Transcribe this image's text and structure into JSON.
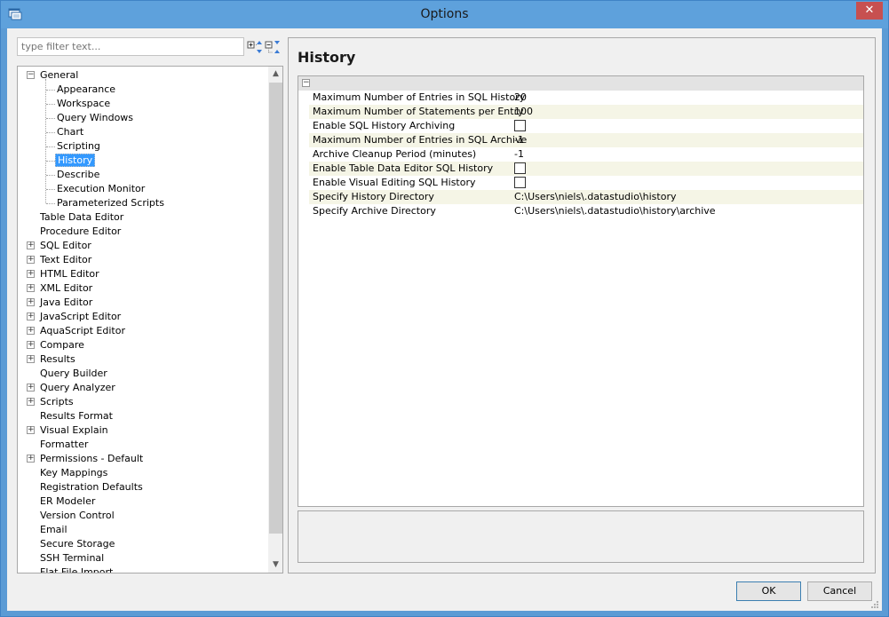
{
  "window": {
    "title": "Options",
    "close_glyph": "✕"
  },
  "filter": {
    "placeholder": "type filter text...",
    "expand_all_icon": "expand-all-icon",
    "collapse_all_icon": "collapse-all-icon"
  },
  "tree": {
    "items": [
      {
        "label": "General",
        "level": 0,
        "expander": "−"
      },
      {
        "label": "Appearance",
        "level": 1
      },
      {
        "label": "Workspace",
        "level": 1
      },
      {
        "label": "Query Windows",
        "level": 1
      },
      {
        "label": "Chart",
        "level": 1
      },
      {
        "label": "Scripting",
        "level": 1
      },
      {
        "label": "History",
        "level": 1,
        "selected": true
      },
      {
        "label": "Describe",
        "level": 1
      },
      {
        "label": "Execution Monitor",
        "level": 1
      },
      {
        "label": "Parameterized Scripts",
        "level": 1
      },
      {
        "label": "Table Data Editor",
        "level": 0
      },
      {
        "label": "Procedure Editor",
        "level": 0
      },
      {
        "label": "SQL Editor",
        "level": 0,
        "expander": "+"
      },
      {
        "label": "Text Editor",
        "level": 0,
        "expander": "+"
      },
      {
        "label": "HTML Editor",
        "level": 0,
        "expander": "+"
      },
      {
        "label": "XML Editor",
        "level": 0,
        "expander": "+"
      },
      {
        "label": "Java Editor",
        "level": 0,
        "expander": "+"
      },
      {
        "label": "JavaScript Editor",
        "level": 0,
        "expander": "+"
      },
      {
        "label": "AquaScript Editor",
        "level": 0,
        "expander": "+"
      },
      {
        "label": "Compare",
        "level": 0,
        "expander": "+"
      },
      {
        "label": "Results",
        "level": 0,
        "expander": "+"
      },
      {
        "label": "Query Builder",
        "level": 0
      },
      {
        "label": "Query Analyzer",
        "level": 0,
        "expander": "+"
      },
      {
        "label": "Scripts",
        "level": 0,
        "expander": "+"
      },
      {
        "label": "Results Format",
        "level": 0
      },
      {
        "label": "Visual Explain",
        "level": 0,
        "expander": "+"
      },
      {
        "label": "Formatter",
        "level": 0
      },
      {
        "label": "Permissions - Default",
        "level": 0,
        "expander": "+"
      },
      {
        "label": "Key Mappings",
        "level": 0
      },
      {
        "label": "Registration Defaults",
        "level": 0
      },
      {
        "label": "ER Modeler",
        "level": 0
      },
      {
        "label": "Version Control",
        "level": 0
      },
      {
        "label": "Email",
        "level": 0
      },
      {
        "label": "Secure Storage",
        "level": 0
      },
      {
        "label": "SSH Terminal",
        "level": 0
      },
      {
        "label": "Flat File Import",
        "level": 0
      }
    ],
    "scroll_up_glyph": "▲",
    "scroll_down_glyph": "▼"
  },
  "history": {
    "title": "History",
    "collapse_glyph": "−",
    "properties": [
      {
        "name": "Maximum Number of Entries in SQL History",
        "value": "20",
        "type": "text"
      },
      {
        "name": "Maximum Number of Statements per Entry",
        "value": "100",
        "type": "text"
      },
      {
        "name": "Enable SQL History Archiving",
        "value": "",
        "type": "checkbox",
        "checked": false
      },
      {
        "name": "Maximum Number of Entries in SQL Archive",
        "value": "-1",
        "type": "text"
      },
      {
        "name": "Archive Cleanup Period (minutes)",
        "value": "-1",
        "type": "text"
      },
      {
        "name": "Enable Table Data Editor SQL History",
        "value": "",
        "type": "checkbox",
        "checked": false
      },
      {
        "name": "Enable Visual Editing SQL History",
        "value": "",
        "type": "checkbox",
        "checked": false
      },
      {
        "name": "Specify History Directory",
        "value": "C:\\Users\\niels\\.datastudio\\history",
        "type": "text"
      },
      {
        "name": "Specify Archive Directory",
        "value": "C:\\Users\\niels\\.datastudio\\history\\archive",
        "type": "text"
      }
    ]
  },
  "buttons": {
    "ok": "OK",
    "cancel": "Cancel"
  },
  "colors": {
    "titlebar": "#5ea1dc",
    "selection": "#3399ff",
    "close_button": "#c75050",
    "alt_row": "#f5f5e6"
  }
}
